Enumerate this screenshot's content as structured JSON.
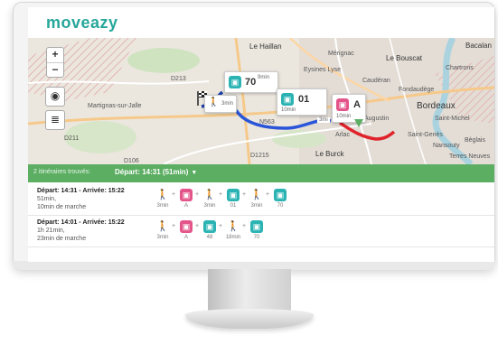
{
  "app": {
    "logo": "moveazy"
  },
  "map": {
    "places": [
      "Le Haillan",
      "Mérignac",
      "Le Bouscat",
      "Bacalan",
      "Chartrons",
      "Caudéran",
      "Fondaudège",
      "Bordeaux",
      "Saint-Michel",
      "Saint-Genès",
      "Nansouty",
      "Bèglais",
      "Terres Neuves",
      "Martignas-sur-Jalle",
      "Arlac",
      "Le Burck",
      "Eysines Lyse",
      "Saint-Augustin",
      "Augustin"
    ],
    "roads": [
      "D213",
      "D106",
      "D211",
      "N563",
      "D1215",
      "D211"
    ],
    "controls": {
      "zoom_in": "+",
      "zoom_out": "−",
      "locate_icon": "◉",
      "layers_icon": "≣"
    },
    "tips": [
      {
        "mode": "walk",
        "duration": "3min"
      },
      {
        "mode": "bus",
        "line": "70",
        "duration": "9min"
      },
      {
        "mode": "bus",
        "line": "01",
        "duration": "10min"
      },
      {
        "mode": "tram",
        "line": "A",
        "duration": "10min"
      }
    ],
    "walk_dur_2": "3mi"
  },
  "summary": {
    "count": "2 itinéraires trouvés:",
    "departure": "Départ: 14:31 (51min)",
    "caret": "▼"
  },
  "itineraries": [
    {
      "times": "Départ: 14:31 - Arrivée: 15:22",
      "duration": "51min,",
      "walk": "10min de marche",
      "steps": [
        {
          "mode": "walk",
          "label": "3min"
        },
        {
          "mode": "tram",
          "label": "A"
        },
        {
          "mode": "walk",
          "label": "3min"
        },
        {
          "mode": "bus",
          "label": "01"
        },
        {
          "mode": "walk",
          "label": "3min"
        },
        {
          "mode": "bus",
          "label": "70"
        }
      ]
    },
    {
      "times": "Départ: 14:01 - Arrivée: 15:22",
      "duration": "1h 21min,",
      "walk": "23min de marche",
      "steps": [
        {
          "mode": "walk",
          "label": "3min"
        },
        {
          "mode": "tram",
          "label": "A"
        },
        {
          "mode": "bus",
          "label": "48"
        },
        {
          "mode": "walk",
          "label": "18min"
        },
        {
          "mode": "bus",
          "label": "70"
        }
      ]
    }
  ],
  "colors": {
    "brand": "#27a69a",
    "bus": "#2bb3b3",
    "tram": "#e3558a",
    "summary_bar": "#5cae63",
    "route_walk": "#1c3fae",
    "route_bus": "#2a55d8",
    "route_tram": "#e0242b"
  }
}
